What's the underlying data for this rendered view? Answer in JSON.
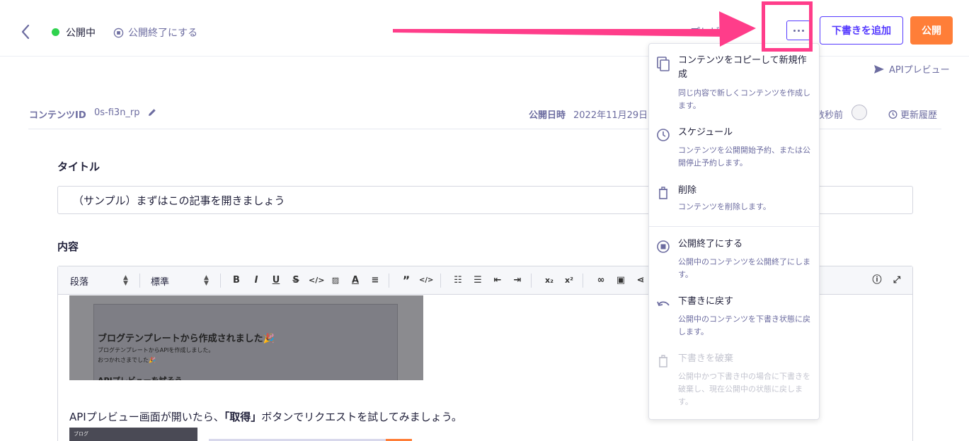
{
  "header": {
    "status_text": "公開中",
    "unpublish_label": "公開終了にする",
    "preview_label": "プレビュー",
    "draft_button_label": "下書きを追加",
    "publish_button_label": "公開",
    "status_color": "#2fd24e",
    "accent_color": "#563bff",
    "publish_color": "#ff7e38"
  },
  "subheader": {
    "api_preview_label": "APIプレビュー"
  },
  "meta": {
    "content_id_label": "コンテンツID",
    "content_id_value": "0s-fi3n_rp",
    "publish_date_label": "公開日時",
    "publish_date_value": "2022年11月29日",
    "updated_value": "数秒前",
    "history_label": "更新履歴"
  },
  "form": {
    "title_label": "タイトル",
    "title_value": "（サンプル）まずはこの記事を開きましょう",
    "content_label": "内容"
  },
  "editor": {
    "paragraph_select": "段落",
    "size_select": "標準",
    "screenshot1_heading": "ブログテンプレートから作成されました🎉",
    "screenshot1_line1": "ブログテンプレートからAPIを作成しました。",
    "screenshot1_line2": "おつかれさまでした🎉",
    "screenshot1_heading2": "APIプレビューを試そう",
    "body_text_before": "APIプレビュー画面が開いたら、",
    "body_text_bold": "「取得」",
    "body_text_after": "ボタンでリクエストを試してみましょう。",
    "screenshot2_text": "ブログ"
  },
  "menu": {
    "items": [
      {
        "title": "コンテンツをコピーして新規作成",
        "desc": "同じ内容で新しくコンテンツを作成します。",
        "icon": "copy-icon"
      },
      {
        "title": "スケジュール",
        "desc": "コンテンツを公開開始予約、または公開停止予約します。",
        "icon": "clock-icon"
      },
      {
        "title": "削除",
        "desc": "コンテンツを削除します。",
        "icon": "trash-icon"
      },
      {
        "title": "公開終了にする",
        "desc": "公開中のコンテンツを公開終了にします。",
        "icon": "stop-icon"
      },
      {
        "title": "下書きに戻す",
        "desc": "公開中のコンテンツを下書き状態に戻します。",
        "icon": "undo-icon"
      },
      {
        "title": "下書きを破棄",
        "desc": "公開中かつ下書き中の場合に下書きを破棄し、現在公開中の状態に戻します。",
        "icon": "trash-icon",
        "disabled": true
      }
    ]
  },
  "annotation": {
    "highlight_color": "#ff3d8a"
  }
}
